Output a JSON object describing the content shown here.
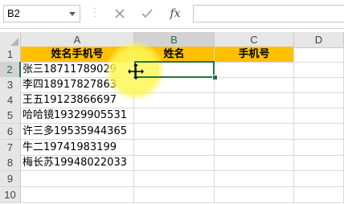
{
  "formula_bar": {
    "name_box": "B2",
    "cancel_icon": "close-icon",
    "enter_icon": "check-icon",
    "fx_label": "fx",
    "formula_value": ""
  },
  "columns": [
    "A",
    "B",
    "C",
    "D"
  ],
  "rows": [
    "1",
    "2",
    "3",
    "4",
    "5",
    "6",
    "7",
    "8",
    "9",
    "10"
  ],
  "header_row": {
    "a": "姓名手机号",
    "b": "姓名",
    "c": "手机号"
  },
  "data_rows": [
    "张三18711789029",
    "李四18917827863",
    "王五19123866697",
    "哈哈镜19329905531",
    "许三多19535944365",
    "牛二19741983199",
    "梅长苏19948022033"
  ],
  "selected_cell": "B2",
  "colors": {
    "header_fill": "#ffc000",
    "selection": "#217346"
  }
}
